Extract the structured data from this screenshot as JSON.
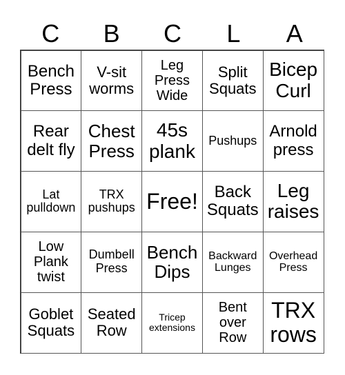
{
  "header": {
    "letters": [
      "C",
      "B",
      "C",
      "L",
      "A"
    ]
  },
  "cells": [
    "Bench\nPress",
    "V-sit\nworms",
    "Leg\nPress\nWide",
    "Split\nSquats",
    "Bicep\nCurl",
    "Rear\ndelt fly",
    "Chest\nPress",
    "45s\nplank",
    "Pushups",
    "Arnold\npress",
    "Lat\npulldown",
    "TRX\npushups",
    "Free!",
    "Back\nSquats",
    "Leg\nraises",
    "Low\nPlank\ntwist",
    "Dumbell\nPress",
    "Bench\nDips",
    "Backward\nLunges",
    "Overhead\nPress",
    "Goblet\nSquats",
    "Seated\nRow",
    "Tricep\nextensions",
    "Bent\nover\nRow",
    "TRX\nrows"
  ]
}
